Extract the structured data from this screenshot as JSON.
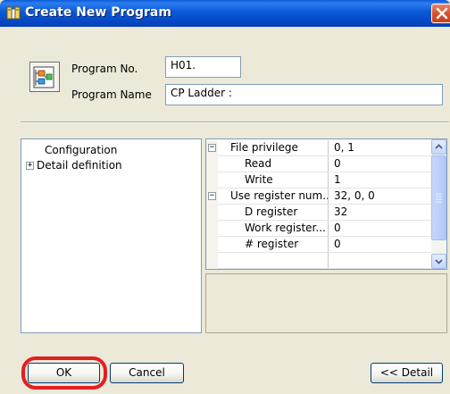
{
  "window": {
    "title": "Create New Program",
    "title_icon": "app-icon",
    "close_icon": "close-icon"
  },
  "program": {
    "number_label": "Program No.",
    "number_value": "H01.",
    "name_label": "Program Name",
    "name_value": "CP Ladder :",
    "icon": "program-icon"
  },
  "tree": {
    "items": [
      {
        "label": "Configuration"
      },
      {
        "label": "Detail definition",
        "expander": "+"
      }
    ]
  },
  "properties": {
    "rows": [
      {
        "name": "File privilege",
        "value": "0, 1",
        "category": true,
        "expander": "−"
      },
      {
        "name": "Read",
        "value": "0"
      },
      {
        "name": "Write",
        "value": "1"
      },
      {
        "name": "Use register num...",
        "value": "32, 0, 0",
        "category": true,
        "expander": "−"
      },
      {
        "name": "D register",
        "value": "32"
      },
      {
        "name": "Work register...",
        "value": "0"
      },
      {
        "name": "# register",
        "value": "0"
      }
    ]
  },
  "buttons": {
    "ok": "OK",
    "cancel": "Cancel",
    "detail": "<< Detail"
  },
  "colors": {
    "highlight": "#e31f1f",
    "titlebar": "#0a58d6",
    "dialog_bg": "#ece9d8"
  }
}
